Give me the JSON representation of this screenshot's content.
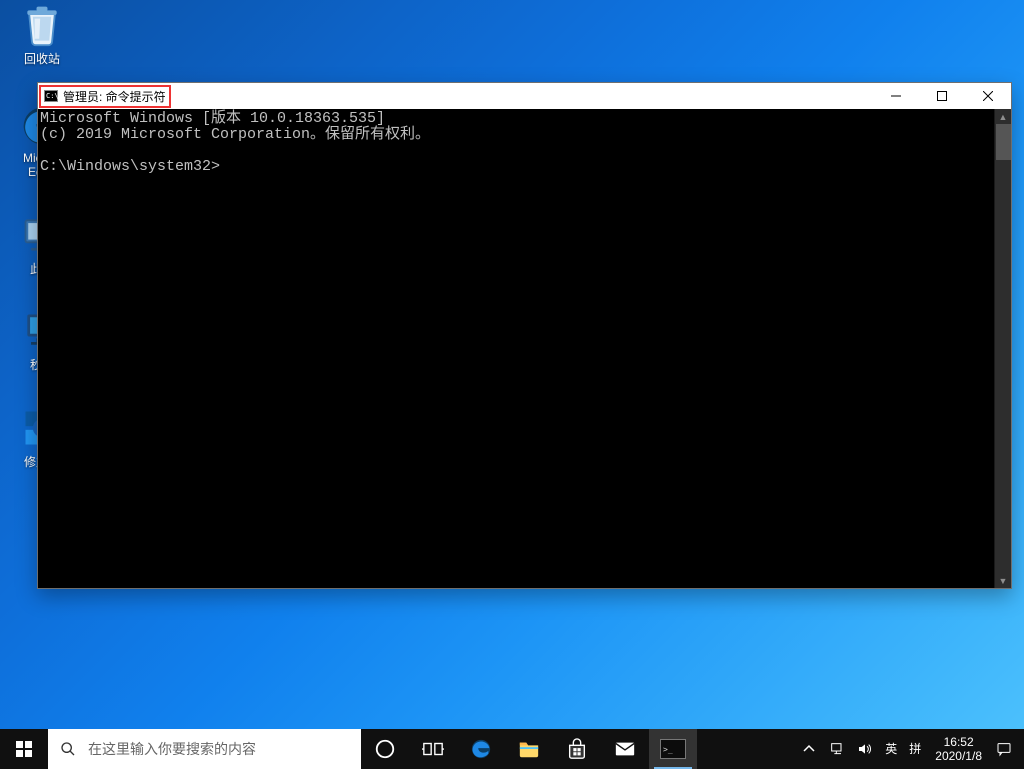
{
  "desktop_icons": [
    {
      "id": "recycle-bin",
      "label": "回收站"
    },
    {
      "id": "edge",
      "label": "Microsoft Edge"
    },
    {
      "id": "this-pc",
      "label": "此电"
    },
    {
      "id": "shutdown",
      "label": "秒关"
    },
    {
      "id": "repair",
      "label": "修复开"
    }
  ],
  "cmd": {
    "title": "管理员: 命令提示符",
    "icon_text": "C:\\",
    "body_line1": "Microsoft Windows [版本 10.0.18363.535]",
    "body_line2": "(c) 2019 Microsoft Corporation。保留所有权利。",
    "prompt_label_left": "Micr",
    "prompt": "C:\\Windows\\system32>",
    "left_edge_label": "Ed"
  },
  "taskbar": {
    "search_placeholder": "在这里输入你要搜索的内容",
    "lang_top": "英",
    "lang_bottom": "拼",
    "clock_time": "16:52",
    "clock_date": "2020/1/8"
  }
}
